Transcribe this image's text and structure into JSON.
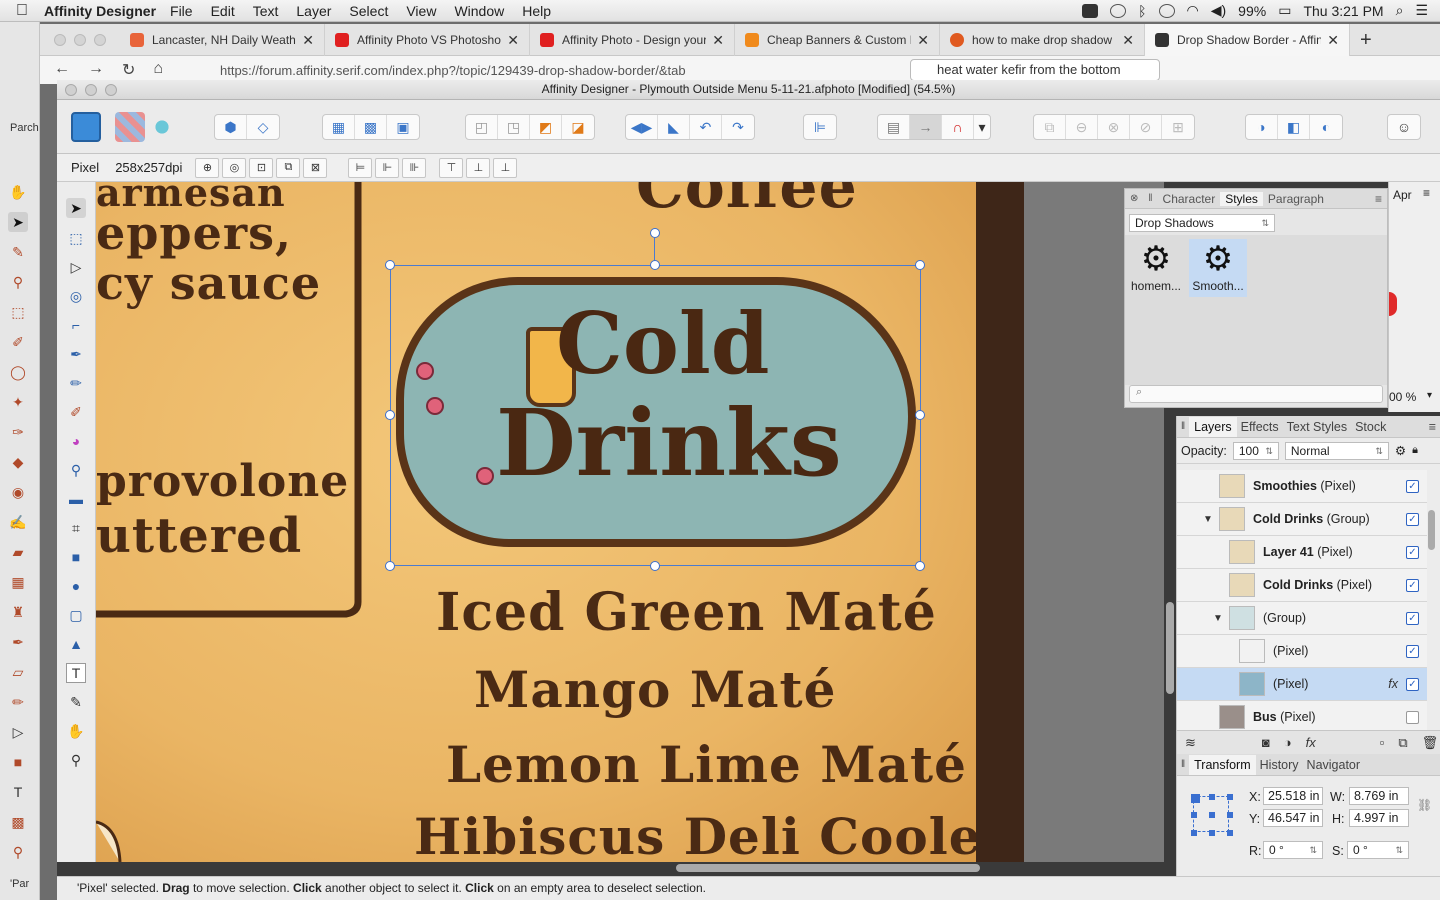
{
  "menubar": {
    "app": "Affinity Designer",
    "items": [
      "File",
      "Edit",
      "Text",
      "Layer",
      "Select",
      "View",
      "Window",
      "Help"
    ],
    "battery": "99%",
    "clock": "Thu 3:21 PM"
  },
  "browser": {
    "tabs": [
      {
        "label": "Lancaster, NH Daily Weather",
        "color": "#e8643a"
      },
      {
        "label": "Affinity Photo VS Photoshop",
        "color": "#e02020"
      },
      {
        "label": "Affinity Photo - Design your",
        "color": "#e02020"
      },
      {
        "label": "Cheap Banners & Custom B",
        "color": "#f08a1c"
      },
      {
        "label": "how to make drop shadow",
        "color": "#e05a20"
      },
      {
        "label": "Drop Shadow Border - Affini",
        "color": "#333333"
      }
    ],
    "url": "https://forum.affinity.serif.com/index.php?/topic/129439-drop-shadow-border/&tab",
    "search": "heat water kefir from the bottom"
  },
  "leftstrip": {
    "top_label": "Parch",
    "bottom_label": "'Par"
  },
  "window": {
    "title": "Affinity Designer - Plymouth Outside Menu 5-11-21.afphoto [Modified] (54.5%)"
  },
  "context": {
    "unit": "Pixel",
    "dpi": "258x257dpi"
  },
  "canvas": {
    "lines_left": [
      "armesan",
      "eppers,",
      "cy sauce",
      "provolone",
      "uttered"
    ],
    "title_top": "Coffee",
    "cold": "Cold",
    "drinks": "Drinks",
    "menu_items": [
      "Iced Green Maté",
      "Mango Maté",
      "Lemon Lime Maté",
      "Hibiscus Deli Cooler"
    ]
  },
  "styles": {
    "tabs": [
      "Character",
      "Styles",
      "Paragraph"
    ],
    "category": "Drop Shadows",
    "items": [
      {
        "label": "homem..."
      },
      {
        "label": "Smooth..."
      }
    ],
    "right_label": "Apr",
    "zoom_label": "00 %"
  },
  "layers": {
    "tabs": [
      "Layers",
      "Effects",
      "Text Styles",
      "Stock"
    ],
    "opacity_label": "Opacity:",
    "opacity": "100",
    "blend": "Normal",
    "rows": [
      {
        "name": "Smoothies",
        "type": "(Pixel)",
        "checked": true
      },
      {
        "name": "Cold Drinks",
        "type": "(Group)",
        "checked": true
      },
      {
        "name": "Layer 41",
        "type": "(Pixel)",
        "checked": true
      },
      {
        "name": "Cold Drinks",
        "type": "(Pixel)",
        "checked": true
      },
      {
        "name": "",
        "type": "(Group)",
        "checked": true
      },
      {
        "name": "",
        "type": "(Pixel)",
        "checked": true
      },
      {
        "name": "",
        "type": "(Pixel)",
        "checked": true
      },
      {
        "name": "Bus",
        "type": "(Pixel)",
        "checked": false
      }
    ]
  },
  "transform": {
    "tabs": [
      "Transform",
      "History",
      "Navigator"
    ],
    "x": "25.518 in",
    "y": "46.547 in",
    "w": "8.769 in",
    "h": "4.997 in",
    "r": "0 °",
    "s": "0 °"
  },
  "status": {
    "p1": "'Pixel' selected. ",
    "b1": "Drag",
    "p2": " to move selection. ",
    "b2": "Click",
    "p3": " another object to select it. ",
    "b3": "Click",
    "p4": " on an empty area to deselect selection."
  }
}
